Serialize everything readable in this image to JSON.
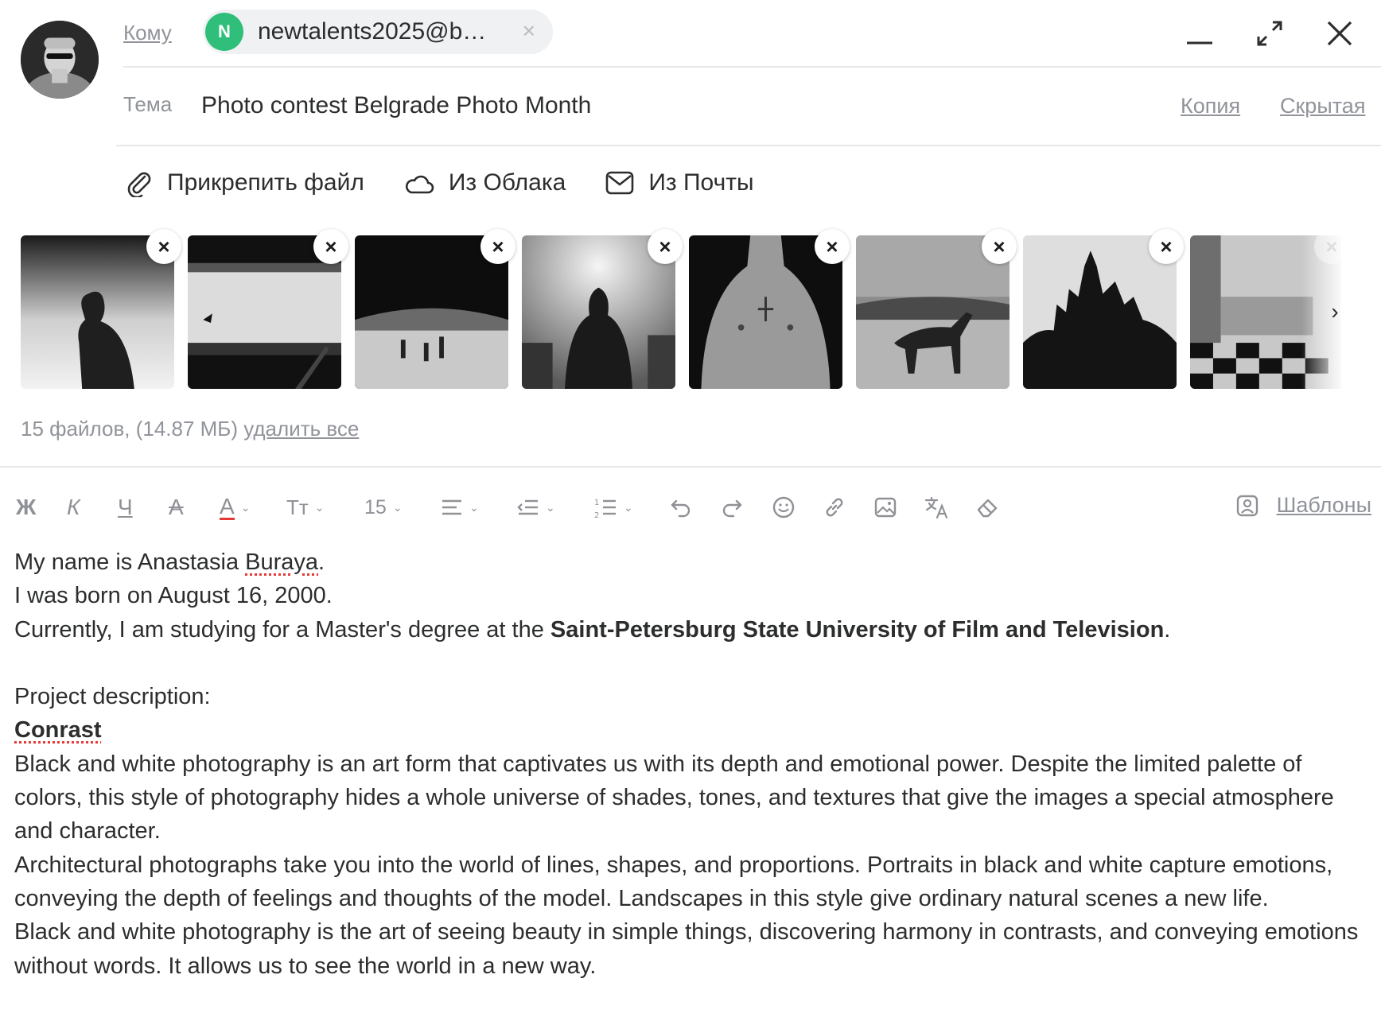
{
  "recipient": {
    "to_label": "Кому",
    "chip_initial": "N",
    "chip_email": "newtalents2025@b…",
    "chip_close": "×",
    "chip_color": "#2fbf7a"
  },
  "subject": {
    "label": "Тема",
    "value": "Photo contest Belgrade Photo Month",
    "cc_label": "Копия",
    "bcc_label": "Скрытая"
  },
  "window_controls": {
    "minimize_icon": "minimize-icon",
    "expand_icon": "expand-icon",
    "close_icon": "close-icon"
  },
  "attach": {
    "attach_file": "Прикрепить файл",
    "from_cloud": "Из Облака",
    "from_mail": "Из Почты"
  },
  "attachments": {
    "items": [
      {
        "subject": "man in profile silhouette"
      },
      {
        "subject": "bridge underside with bird"
      },
      {
        "subject": "beach with people and bridge"
      },
      {
        "subject": "man from behind in crowd"
      },
      {
        "subject": "male torso with cross tattoo"
      },
      {
        "subject": "horse in field"
      },
      {
        "subject": "St. Basil's Cathedral silhouette"
      },
      {
        "subject": "room with checkered floor"
      }
    ],
    "remove_label": "×",
    "next_label": "›",
    "summary_prefix": "15 файлов, (14.87 МБ) ",
    "delete_all": "удалить все"
  },
  "toolbar": {
    "bold": "Ж",
    "italic": "К",
    "underline": "Ч",
    "strike": "А",
    "text_color": "А",
    "font_size_style": "Тт",
    "font_size": "15",
    "templates": "Шаблоны",
    "accent_color": "#e53935"
  },
  "body": {
    "line1_before": "My name is Anastasia ",
    "line1_name": "Buraya",
    "line1_after": ".",
    "line2": "I was born on August 16, 2000.",
    "line3_before": "Currently, I am studying for a Master's degree at the ",
    "line3_bold": "Saint-Petersburg State University of Film and Television",
    "line3_after": ".",
    "project_label": "Project description:",
    "project_title": "Conrast",
    "para1": "Black and white photography is an art form that captivates us with its depth and emotional power. Despite the limited palette of colors, this style of photography hides a whole universe of shades, tones, and textures that give the images a special atmosphere and character.",
    "para2": "Architectural photographs take you into the world of lines, shapes, and proportions. Portraits in black and white capture emotions, conveying the depth of feelings and thoughts of the model. Landscapes in this style give ordinary natural scenes a new life.",
    "para3": "Black and white photography is the art of seeing beauty in simple things, discovering harmony in contrasts, and conveying emotions without words. It allows us to see the world in a new way."
  }
}
